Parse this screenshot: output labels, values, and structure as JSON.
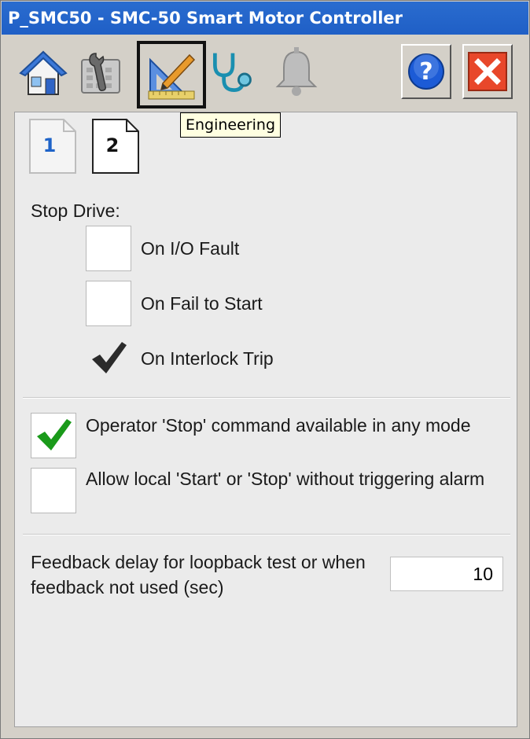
{
  "window": {
    "title": "P_SMC50 - SMC-50 Smart Motor Controller"
  },
  "toolbar": {
    "tools": [
      {
        "name": "home",
        "icon": "home-icon"
      },
      {
        "name": "maintenance",
        "icon": "maintenance-icon"
      },
      {
        "name": "engineering",
        "icon": "engineering-icon",
        "selected": true
      },
      {
        "name": "diagnostics",
        "icon": "stethoscope-icon"
      },
      {
        "name": "alarms",
        "icon": "bell-icon"
      }
    ],
    "tooltip": "Engineering",
    "help_icon": "help-icon",
    "close_icon": "close-icon"
  },
  "pages": {
    "page1": "1",
    "page2": "2",
    "active": "2"
  },
  "stop_drive": {
    "heading": "Stop Drive:",
    "options": [
      {
        "label": "On I/O Fault",
        "checked": false
      },
      {
        "label": "On Fail to Start",
        "checked": false
      },
      {
        "label": "On Interlock Trip",
        "checked": true
      }
    ]
  },
  "operator": {
    "stop_any_mode": {
      "label": "Operator 'Stop' command available in any mode",
      "checked": true
    },
    "local_no_alarm": {
      "label": "Allow local 'Start' or 'Stop' without triggering alarm",
      "checked": false
    }
  },
  "feedback": {
    "label": "Feedback delay for loopback test or when feedback not used (sec)",
    "value": "10"
  },
  "colors": {
    "titlebar": "#1f5fc6",
    "check_green": "#1a9a1a",
    "close_red": "#e8472a",
    "help_blue": "#1c5bd6"
  }
}
